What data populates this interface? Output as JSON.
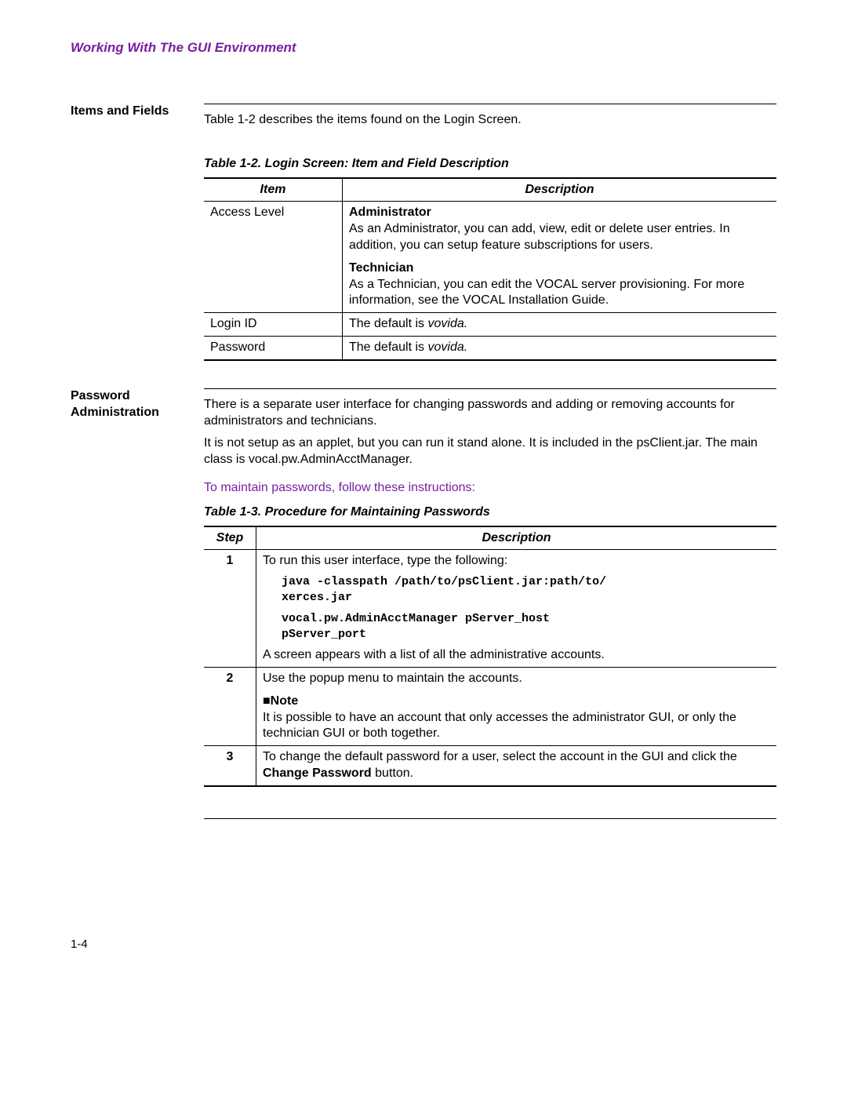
{
  "header": {
    "title": "Working With The GUI Environment"
  },
  "sections": {
    "items_and_fields": {
      "label": "Items and Fields",
      "intro": "Table 1-2 describes the items found on the Login Screen.",
      "table_caption": "Table 1-2. Login Screen: Item and Field Description",
      "headers": {
        "item": "Item",
        "description": "Description"
      },
      "row_access": {
        "item": "Access Level",
        "admin_head": "Administrator",
        "admin_body": "As an Administrator, you can add, view, edit or delete user entries. In addition, you can setup feature subscriptions for users.",
        "tech_head": "Technician",
        "tech_body": "As a Technician, you can edit the VOCAL server provisioning. For more information, see the VOCAL Installation Guide."
      },
      "row_login": {
        "item": "Login ID",
        "desc_pre": "The default is ",
        "desc_em": "vovida."
      },
      "row_password": {
        "item": "Password",
        "desc_pre": "The default is ",
        "desc_em": "vovida."
      }
    },
    "password_admin": {
      "label": "Password Administration",
      "p1": "There is a separate user interface for changing passwords and adding or removing accounts for administrators and technicians.",
      "p2": "It is not setup as an applet, but you can run it stand alone. It is included in the psClient.jar. The main class is vocal.pw.AdminAcctManager.",
      "instruction": "To maintain passwords, follow these instructions:",
      "table_caption": "Table 1-3. Procedure for Maintaining Passwords",
      "headers": {
        "step": "Step",
        "description": "Description"
      },
      "step1": {
        "num": "1",
        "intro": "To run this user interface, type the following:",
        "code1": "java -classpath /path/to/psClient.jar:path/to/",
        "code1b": "xerces.jar",
        "code2": "vocal.pw.AdminAcctManager pServer_host",
        "code2b": "pServer_port",
        "outro": "A screen appears with a list of all the administrative accounts."
      },
      "step2": {
        "num": "2",
        "intro": "Use the popup menu to maintain the accounts.",
        "note_head": "■Note",
        "note_body": "It is possible to have an account that only accesses the administrator GUI, or only the technician GUI or both together."
      },
      "step3": {
        "num": "3",
        "p_pre": "To change the default password for a user, select the account in the GUI and click the ",
        "p_strong": "Change Password",
        "p_post": " button."
      }
    }
  },
  "footer": {
    "page": "1-4"
  }
}
